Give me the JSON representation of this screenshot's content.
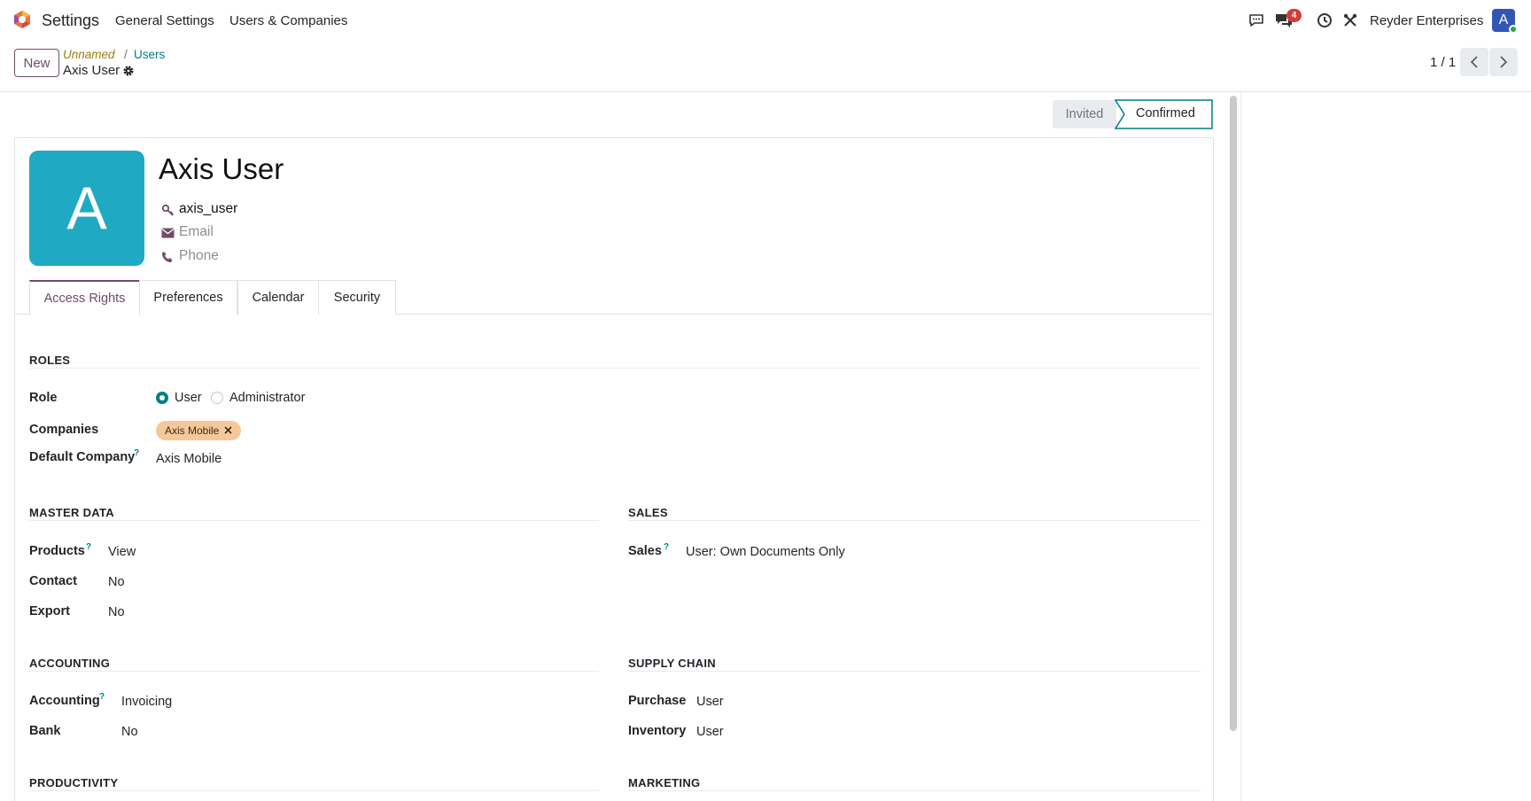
{
  "nav": {
    "app_name": "Settings",
    "menu": [
      "General Settings",
      "Users & Companies"
    ],
    "message_count": "4",
    "company": "Reyder Enterprises",
    "avatar_letter": "A"
  },
  "control_panel": {
    "new_label": "New",
    "breadcrumb": {
      "unnamed": "Unnamed",
      "separator": "/",
      "users": "Users",
      "current": "Axis User"
    },
    "pager": "1 / 1"
  },
  "status": {
    "invited": "Invited",
    "confirmed": "Confirmed"
  },
  "user": {
    "avatar_letter": "A",
    "name": "Axis User",
    "login": "axis_user",
    "email_placeholder": "Email",
    "phone_placeholder": "Phone"
  },
  "tabs": [
    "Access Rights",
    "Preferences",
    "Calendar",
    "Security"
  ],
  "roles": {
    "title": "ROLES",
    "role_label": "Role",
    "role_options": [
      "User",
      "Administrator"
    ],
    "role_selected": "User",
    "companies_label": "Companies",
    "company_tag": "Axis Mobile",
    "default_company_label": "Default Company",
    "default_company_value": "Axis Mobile",
    "help_mark": "?"
  },
  "master_data": {
    "title": "MASTER DATA",
    "rows": [
      {
        "label": "Products",
        "value": "View",
        "help": "?"
      },
      {
        "label": "Contact",
        "value": "No",
        "help": ""
      },
      {
        "label": "Export",
        "value": "No",
        "help": ""
      }
    ]
  },
  "sales": {
    "title": "SALES",
    "rows": [
      {
        "label": "Sales",
        "value": "User: Own Documents Only",
        "help": "?"
      }
    ]
  },
  "accounting": {
    "title": "ACCOUNTING",
    "rows": [
      {
        "label": "Accounting",
        "value": "Invoicing",
        "help": "?"
      },
      {
        "label": "Bank",
        "value": "No",
        "help": ""
      }
    ]
  },
  "supply_chain": {
    "title": "SUPPLY CHAIN",
    "rows": [
      {
        "label": "Purchase",
        "value": "User",
        "help": ""
      },
      {
        "label": "Inventory",
        "value": "User",
        "help": ""
      }
    ]
  },
  "productivity": {
    "title": "PRODUCTIVITY"
  },
  "marketing": {
    "title": "MARKETING"
  },
  "colors": {
    "brand": "#714b67",
    "accent": "#017e84",
    "avatar": "#20a9c2",
    "tag": "#f5c89a",
    "badge": "#d43c3c"
  }
}
